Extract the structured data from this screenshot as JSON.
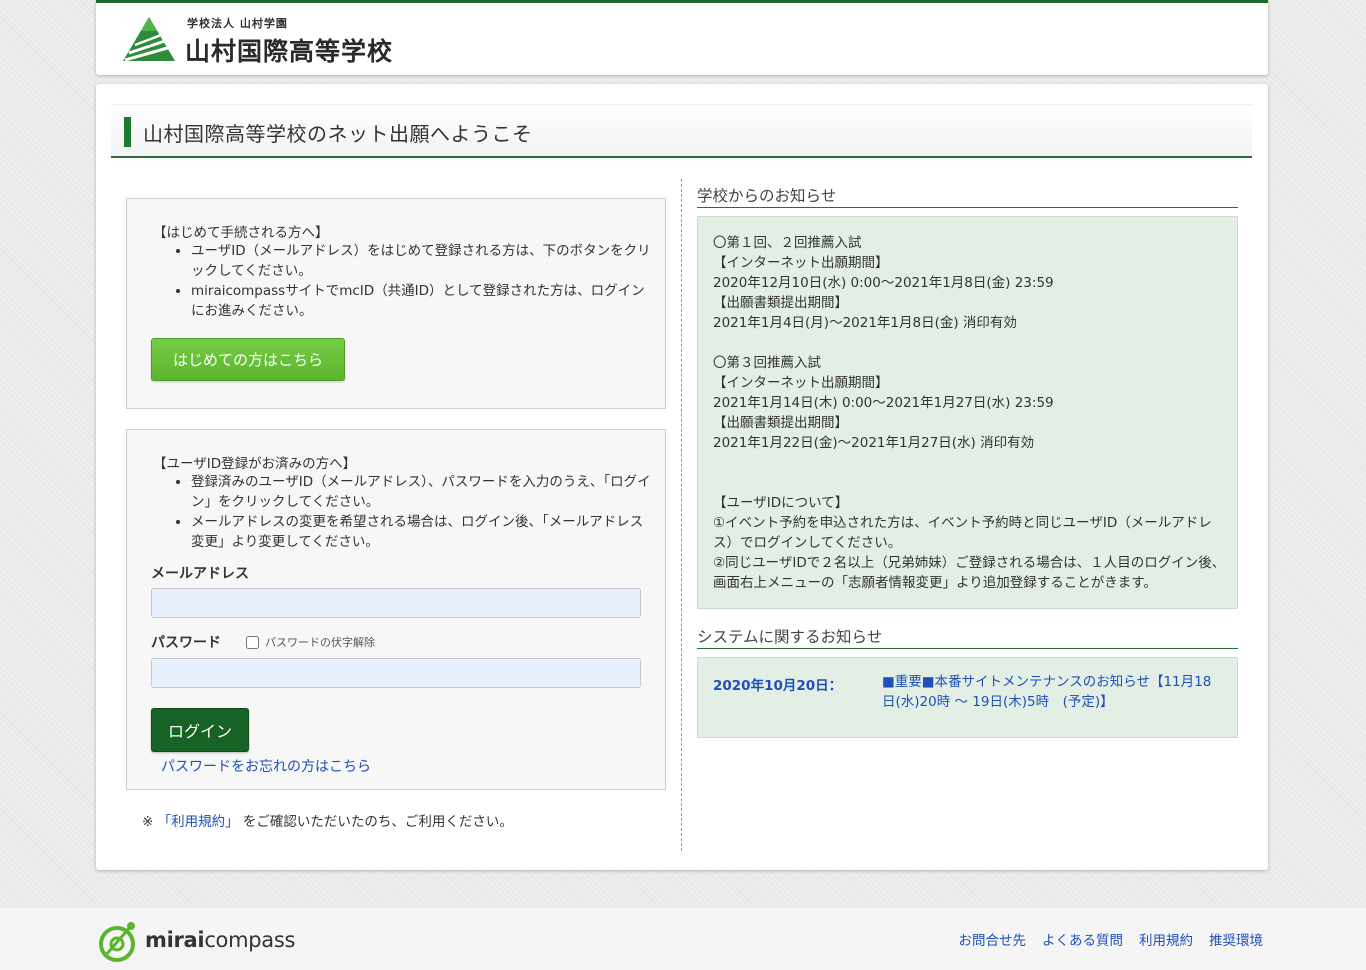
{
  "header": {
    "logo_sub": "学校法人 山村学園",
    "logo_main": "山村国際高等学校",
    "logo_icon": "tree-triangle-logo-icon"
  },
  "page_title": "山村国際高等学校のネット出願へようこそ",
  "first_time": {
    "title": "【はじめて手続される方へ】",
    "items": [
      "ユーザID（メールアドレス）をはじめて登録される方は、下のボタンをクリックしてください。",
      "miraicompassサイトでmcID（共通ID）として登録された方は、ログインにお進みください。"
    ],
    "button_label": "はじめての方はこちら"
  },
  "login": {
    "title": "【ユーザID登録がお済みの方へ】",
    "items": [
      "登録済みのユーザID（メールアドレス）、パスワードを入力のうえ、「ログイン」をクリックしてください。",
      "メールアドレスの変更を希望される場合は、ログイン後、「メールアドレス変更」より変更してください。"
    ],
    "email_label": "メールアドレス",
    "email_value": "",
    "password_label": "パスワード",
    "password_value": "",
    "show_password_label": "パスワードの伏字解除",
    "show_password_checked": false,
    "login_button": "ログイン",
    "forgot_link": "パスワードをお忘れの方はこちら"
  },
  "terms": {
    "prefix": "※ ",
    "link": "「利用規約」",
    "suffix": " をご確認いただいたのち、ご利用ください。"
  },
  "school_notice": {
    "title": "学校からのお知らせ",
    "lines": [
      "〇第１回、２回推薦入試",
      "【インターネット出願期間】",
      "2020年12月10日(水) 0:00～2021年1月8日(金) 23:59",
      "【出願書類提出期間】",
      "2021年1月4日(月)～2021年1月8日(金) 消印有効",
      "",
      "〇第３回推薦入試",
      "【インターネット出願期間】",
      "2021年1月14日(木) 0:00～2021年1月27日(水) 23:59",
      "【出願書類提出期間】",
      "2021年1月22日(金)～2021年1月27日(水) 消印有効",
      "",
      "",
      "【ユーザIDについて】",
      "①イベント予約を申込された方は、イベント予約時と同じユーザID（メールアドレス）でログインしてください。",
      "②同じユーザIDで２名以上（兄弟姉妹）ご登録される場合は、１人目のログイン後、画面右上メニューの「志願者情報変更」より追加登録することがきます。"
    ]
  },
  "system_notice": {
    "title": "システムに関するお知らせ",
    "date": "2020年10月20日：",
    "link": "■重要■本番サイトメンテナンスのお知らせ【11月18日(水)20時 ～ 19日(木)5時　(予定)】"
  },
  "footer": {
    "brand_bold": "mirai",
    "brand_light": "compass",
    "links": [
      "お問合せ先",
      "よくある質問",
      "利用規約",
      "推奨環境"
    ]
  },
  "colors": {
    "accent_green": "#1d7a30",
    "button_green": "#5bb52c",
    "login_green": "#176325",
    "link_blue": "#1f4fb8",
    "notice_bg": "#e3efe5"
  }
}
